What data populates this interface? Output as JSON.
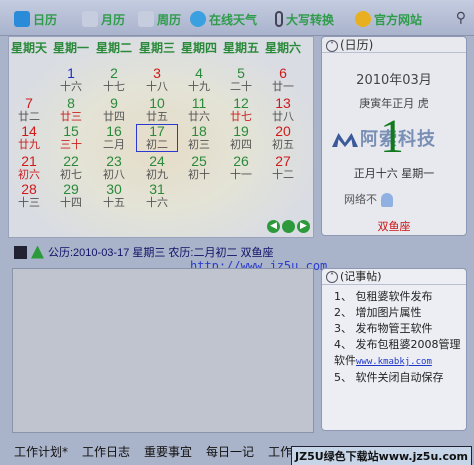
{
  "toolbar": {
    "items": [
      {
        "label": "日历",
        "icon": "calendar-icon"
      },
      {
        "label": "月历",
        "icon": "month-icon"
      },
      {
        "label": "周历",
        "icon": "week-icon"
      },
      {
        "label": "在线天气",
        "icon": "weather-icon"
      },
      {
        "label": "大写转换",
        "icon": "paperclip-icon"
      },
      {
        "label": "官方网站",
        "icon": "sun-icon"
      }
    ]
  },
  "calendar": {
    "weekdays": [
      "星期天",
      "星期一",
      "星期二",
      "星期三",
      "星期四",
      "星期五",
      "星期六"
    ],
    "weeks": [
      [
        null,
        {
          "d": "1",
          "l": "十六",
          "c": "blue"
        },
        {
          "d": "2",
          "l": "十七",
          "c": "green"
        },
        {
          "d": "3",
          "l": "十八",
          "c": "red"
        },
        {
          "d": "4",
          "l": "十九",
          "c": "green"
        },
        {
          "d": "5",
          "l": "二十",
          "c": "green"
        },
        {
          "d": "6",
          "l": "廿一",
          "c": "red"
        }
      ],
      [
        {
          "d": "7",
          "l": "廿二",
          "c": "red"
        },
        {
          "d": "8",
          "l": "廿三",
          "c": "green",
          "lc": "red"
        },
        {
          "d": "9",
          "l": "廿四",
          "c": "green"
        },
        {
          "d": "10",
          "l": "廿五",
          "c": "green"
        },
        {
          "d": "11",
          "l": "廿六",
          "c": "green"
        },
        {
          "d": "12",
          "l": "廿七",
          "c": "green",
          "lc": "red"
        },
        {
          "d": "13",
          "l": "廿八",
          "c": "red"
        }
      ],
      [
        {
          "d": "14",
          "l": "廿九",
          "c": "red",
          "lc": "red"
        },
        {
          "d": "15",
          "l": "三十",
          "c": "green",
          "lc": "red"
        },
        {
          "d": "16",
          "l": "二月",
          "c": "green"
        },
        {
          "d": "17",
          "l": "初二",
          "c": "green",
          "today": true
        },
        {
          "d": "18",
          "l": "初三",
          "c": "green"
        },
        {
          "d": "19",
          "l": "初四",
          "c": "green"
        },
        {
          "d": "20",
          "l": "初五",
          "c": "red"
        }
      ],
      [
        {
          "d": "21",
          "l": "初六",
          "c": "red",
          "lc": "red"
        },
        {
          "d": "22",
          "l": "初七",
          "c": "green"
        },
        {
          "d": "23",
          "l": "初八",
          "c": "green"
        },
        {
          "d": "24",
          "l": "初九",
          "c": "green"
        },
        {
          "d": "25",
          "l": "初十",
          "c": "green"
        },
        {
          "d": "26",
          "l": "十一",
          "c": "green"
        },
        {
          "d": "27",
          "l": "十二",
          "c": "red"
        }
      ],
      [
        {
          "d": "28",
          "l": "十三",
          "c": "red"
        },
        {
          "d": "29",
          "l": "十四",
          "c": "green"
        },
        {
          "d": "30",
          "l": "十五",
          "c": "green"
        },
        {
          "d": "31",
          "l": "十六",
          "c": "green"
        },
        null,
        null,
        null
      ]
    ]
  },
  "daypanel": {
    "header": "(日历)",
    "year_month": "2010年03月",
    "ganzhi": "庚寅年正月 虎",
    "logo_text": "阿索科技",
    "day": "1",
    "lunar": "正月十六 星期一",
    "net": "网络不",
    "star_sign": "双鱼座"
  },
  "status": {
    "text": "公历:2010-03-17 星期三 农历:二月初二 双鱼座",
    "url": "http://www.jz5u.com"
  },
  "notes": {
    "header": "(记事帖)",
    "items": [
      "1、 包租婆软件发布",
      "2、 增加图片属性",
      "3、 发布物管王软件",
      "4、 发布包租婆2008管理软件",
      "5、 软件关闭自动保存"
    ],
    "link": "www.kmabkj.com"
  },
  "tabs": [
    "工作计划*",
    "工作日志",
    "重要事宜",
    "每日一记",
    "工作总"
  ],
  "brand": "JZ5U绿色下载站www.jz5u.com"
}
